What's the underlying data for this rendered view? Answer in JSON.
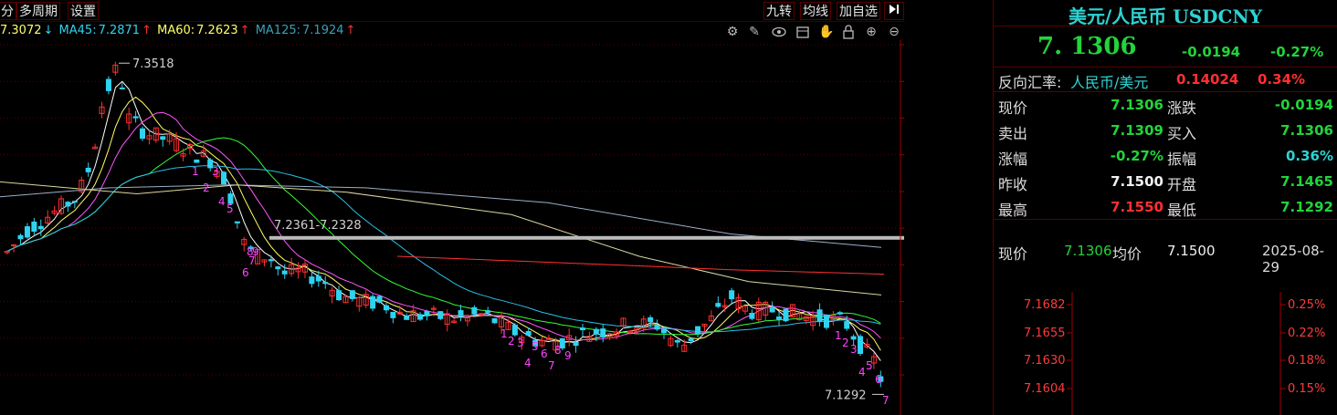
{
  "toolbar": {
    "left_tabs": [
      "分",
      "多周期",
      "设置"
    ],
    "right_buttons": [
      "九转",
      "均线",
      "加自选"
    ],
    "arrow_icon": "pin-right-icon"
  },
  "ma_legend": {
    "ma_first": "7.3072",
    "ma_first_arrow": "↓",
    "ma45_label": "MA45:",
    "ma45": "7.2871",
    "ma45_arrow": "↑",
    "ma60_label": "MA60:",
    "ma60": "7.2623",
    "ma60_arrow": "↑",
    "ma125_label": "MA125:",
    "ma125": "7.1924",
    "ma125_arrow": "↑"
  },
  "chart_tools": [
    "gear-icon",
    "pen-icon",
    "eye-icon",
    "save-icon",
    "hand-icon",
    "lock-icon",
    "zoom-in-icon",
    "zoom-out-icon"
  ],
  "chart_data": {
    "type": "candlestick",
    "y_ticks": [
      "7.3642",
      "7.3395",
      "7.3149",
      "7.2902",
      "7.2655",
      "7.2409",
      "7.2162",
      "7.1916",
      "7.1669",
      "7.1423"
    ],
    "ylim": [
      7.1217,
      7.3782
    ],
    "colors": {
      "up": "#ff3030",
      "down": "#2ed3f0",
      "ma5": "#ffffff",
      "ma10": "#ffff66",
      "ma20": "#ff55ff",
      "ma45": "#33ff33",
      "ma60": "#28c0e8",
      "ma125": "#9ab0c8"
    },
    "annotations": {
      "high": "7.3518",
      "low": "7.1292",
      "range": "7.2361-7.2328"
    },
    "nine_turn_labels": [
      "1",
      "2",
      "3",
      "4",
      "5",
      "6",
      "7",
      "8",
      "9",
      "1",
      "2",
      "3",
      "4",
      "5",
      "6",
      "7",
      "8",
      "9",
      "1",
      "2",
      "3",
      "4",
      "5",
      "6",
      "7"
    ]
  },
  "quote": {
    "title": "美元/人民币 USDCNY",
    "price": "7. 1306",
    "change": "-0.0194",
    "change_pct": "-0.27%",
    "reverse_label": "反向汇率:",
    "reverse_pair": "人民币/美元",
    "reverse_value": "0.14024",
    "reverse_pct": "0.34%",
    "rows": [
      {
        "l1": "现价",
        "v1": "7.1306",
        "l2": "涨跌",
        "v2": "-0.0194"
      },
      {
        "l1": "卖出",
        "v1": "7.1309",
        "l2": "买入",
        "v2": "7.1306"
      },
      {
        "l1": "涨幅",
        "v1": "-0.27%",
        "l2": "振幅",
        "v2": "0.36%"
      },
      {
        "l1": "昨收",
        "v1": "7.1500",
        "l2": "开盘",
        "v2": "7.1465"
      },
      {
        "l1": "最高",
        "v1": "7.1550",
        "l2": "最低",
        "v2": "7.1292"
      }
    ],
    "intraday": {
      "price_label": "现价",
      "price": "7.1306",
      "avg_label": "均价",
      "avg": "7.1500",
      "date": "2025-08-29"
    },
    "intraday_axis_prices": [
      "7.1682",
      "7.1655",
      "7.1630",
      "7.1604"
    ],
    "intraday_axis_pcts": [
      "0.25%",
      "0.22%",
      "0.18%",
      "0.15%"
    ]
  }
}
